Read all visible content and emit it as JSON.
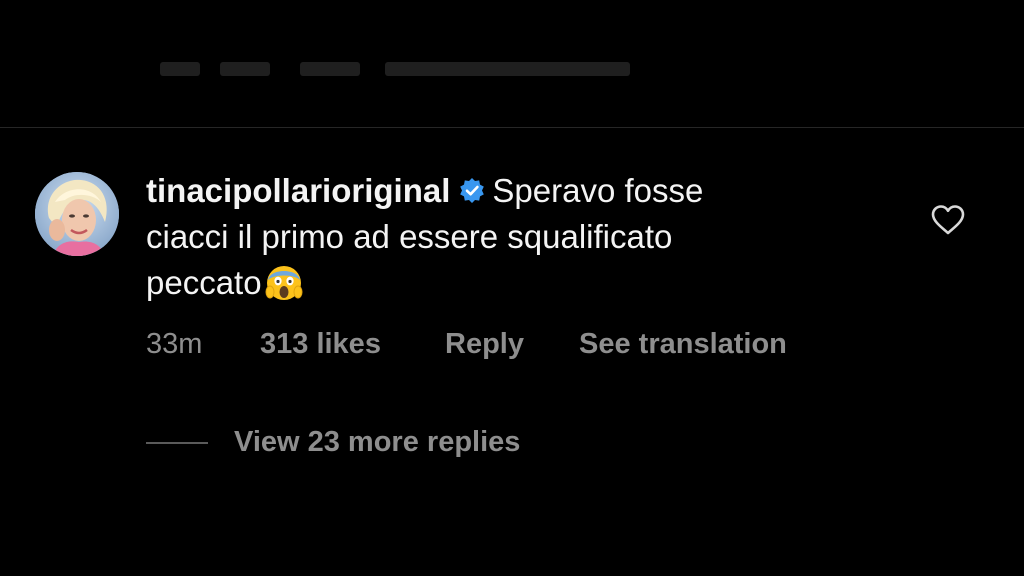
{
  "comment": {
    "username": "tinacipollarioriginal",
    "verified": true,
    "text_line1": "Speravo fosse",
    "text_line2": "ciacci il primo ad essere squalificato",
    "text_line3": "peccato",
    "emoji": "face-screaming-in-fear",
    "time": "33m",
    "likes": "313 likes",
    "reply_label": "Reply",
    "translate_label": "See translation",
    "view_replies": "View 23 more replies"
  },
  "colors": {
    "background": "#000000",
    "text": "#f4f4f4",
    "muted": "#8e8e8e",
    "verified": "#3897f0",
    "divider": "#262626"
  },
  "icons": {
    "verified": "verified-badge-icon",
    "like": "heart-outline-icon",
    "emoji": "screaming-face-emoji-icon"
  }
}
